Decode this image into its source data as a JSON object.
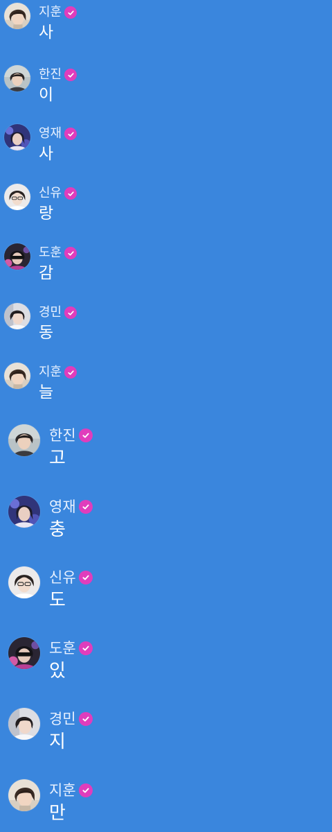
{
  "theme": {
    "background": "#3a86dd",
    "badge_color": "#e03dbc",
    "name_color": "#e8f1ff",
    "text_color": "#ffffff"
  },
  "messages": [
    {
      "name": "지훈",
      "text": "사",
      "verified": true,
      "avatar": "avatar-jihun"
    },
    {
      "name": "한진",
      "text": "이",
      "verified": true,
      "avatar": "avatar-hanjin"
    },
    {
      "name": "영재",
      "text": "사",
      "verified": true,
      "avatar": "avatar-youngjae"
    },
    {
      "name": "신유",
      "text": "랑",
      "verified": true,
      "avatar": "avatar-shinyu"
    },
    {
      "name": "도훈",
      "text": "감",
      "verified": true,
      "avatar": "avatar-dohoon"
    },
    {
      "name": "경민",
      "text": "동",
      "verified": true,
      "avatar": "avatar-kyungmin"
    },
    {
      "name": "지훈",
      "text": "늘",
      "verified": true,
      "avatar": "avatar-jihun"
    },
    {
      "name": "한진",
      "text": "고",
      "verified": true,
      "avatar": "avatar-hanjin"
    },
    {
      "name": "영재",
      "text": "충",
      "verified": true,
      "avatar": "avatar-youngjae"
    },
    {
      "name": "신유",
      "text": "도",
      "verified": true,
      "avatar": "avatar-shinyu"
    },
    {
      "name": "도훈",
      "text": "있",
      "verified": true,
      "avatar": "avatar-dohoon"
    },
    {
      "name": "경민",
      "text": "지",
      "verified": true,
      "avatar": "avatar-kyungmin"
    },
    {
      "name": "지훈",
      "text": "만",
      "verified": true,
      "avatar": "avatar-jihun"
    }
  ]
}
